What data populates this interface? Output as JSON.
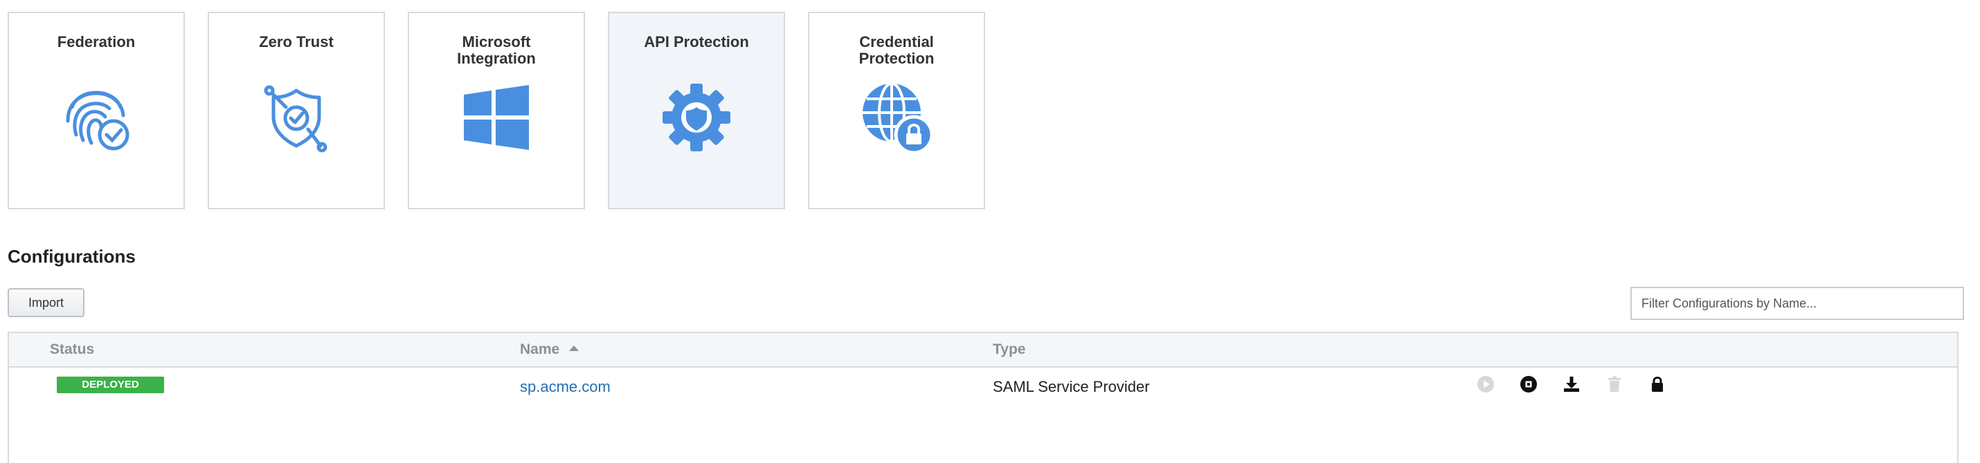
{
  "tiles": [
    {
      "title": "Federation",
      "icon": "fingerprint-check-icon"
    },
    {
      "title": "Zero Trust",
      "icon": "shield-check-icon"
    },
    {
      "title": "Microsoft Integration",
      "icon": "windows-logo-icon"
    },
    {
      "title": "API Protection",
      "icon": "gear-shield-icon",
      "selected": true
    },
    {
      "title": "Credential Protection",
      "icon": "globe-lock-icon"
    }
  ],
  "colors": {
    "accent": "#4a8fdf",
    "deployed": "#3bb149",
    "link": "#1f6fb5"
  },
  "section": {
    "title": "Configurations"
  },
  "toolbar": {
    "import_label": "Import",
    "filter_placeholder": "Filter Configurations by Name..."
  },
  "table": {
    "columns": {
      "status": "Status",
      "name": "Name",
      "type": "Type"
    },
    "sort": {
      "column": "Name",
      "direction": "ascending"
    },
    "rows": [
      {
        "status": "DEPLOYED",
        "name": "sp.acme.com",
        "type": "SAML Service Provider",
        "actions": [
          "play-icon",
          "stop-icon",
          "download-icon",
          "trash-icon",
          "lock-icon"
        ]
      }
    ]
  }
}
